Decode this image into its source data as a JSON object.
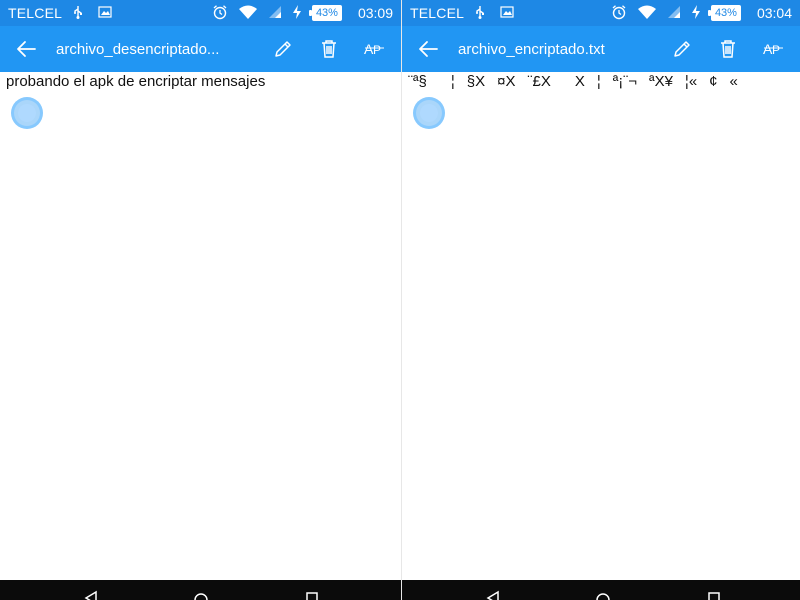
{
  "screens": [
    {
      "status": {
        "carrier": "TELCEL",
        "battery": "43%",
        "time": "03:09"
      },
      "app_bar": {
        "title": "archivo_desencriptado..."
      },
      "content": {
        "text": "probando el apk de encriptar mensajes"
      }
    },
    {
      "status": {
        "carrier": "TELCEL",
        "battery": "43%",
        "time": "03:04"
      },
      "app_bar": {
        "title": "archivo_encriptado.txt"
      },
      "content": {
        "text": "¨ª§¦§X¤X¨£XX¦ª¡¨¬ªX¥¦«¢«"
      }
    }
  ],
  "colors": {
    "status_bar": "#1e88e5",
    "app_bar": "#2196f3",
    "nav_bar": "#0b0b0b"
  },
  "icons": {
    "back": "arrow-back-icon",
    "edit": "pencil-icon",
    "delete": "trash-icon",
    "font": "font-size-icon"
  }
}
